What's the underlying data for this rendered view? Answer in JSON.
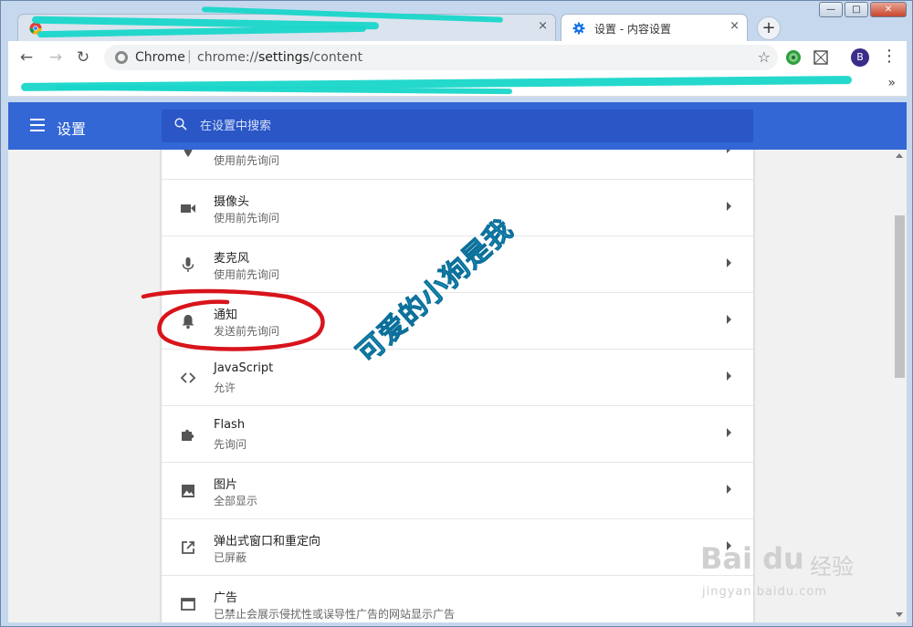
{
  "window": {
    "controls": {
      "minimize": "—",
      "maximize": "□",
      "close": "✕"
    }
  },
  "tabs": [
    {
      "title": "",
      "close": "×",
      "icon": "chrome-logo-icon"
    },
    {
      "title": "设置 - 内容设置",
      "close": "×",
      "icon": "gear-icon"
    }
  ],
  "toolbar": {
    "new_tab": "+",
    "back": "←",
    "forward": "→",
    "reload": "↻",
    "site_label": "Chrome",
    "separator": "|",
    "url_prefix": "chrome://",
    "url_host": "settings",
    "url_path": "/content",
    "star": "☆",
    "avatar_letter": "B",
    "menu": "⋮"
  },
  "bookmarks": {
    "overflow": "»"
  },
  "settings": {
    "title": "设置",
    "search_placeholder": "在设置中搜索"
  },
  "rows": [
    {
      "title": "",
      "subtitle": "使用前先询问",
      "icon": "location-icon"
    },
    {
      "title": "摄像头",
      "subtitle": "使用前先询问",
      "icon": "camera-icon"
    },
    {
      "title": "麦克风",
      "subtitle": "使用前先询问",
      "icon": "microphone-icon"
    },
    {
      "title": "通知",
      "subtitle": "发送前先询问",
      "icon": "bell-icon"
    },
    {
      "title": "JavaScript",
      "subtitle": "允许",
      "icon": "code-icon"
    },
    {
      "title": "Flash",
      "subtitle": "先询问",
      "icon": "puzzle-icon"
    },
    {
      "title": "图片",
      "subtitle": "全部显示",
      "icon": "image-icon"
    },
    {
      "title": "弹出式窗口和重定向",
      "subtitle": "已屏蔽",
      "icon": "open-in-new-icon"
    },
    {
      "title": "广告",
      "subtitle": "已禁止会展示侵扰性或误导性广告的网站显示广告",
      "icon": "ad-window-icon"
    }
  ],
  "annotations": {
    "handwritten": "可爱的小狗是我",
    "watermark_logo": "Bai du",
    "watermark_cn": "经验",
    "watermark_site": "jingyan.baidu.com",
    "circle_color": "#d8141b",
    "handwritten_color": "#3fd6f0"
  },
  "colors": {
    "header_blue": "#3367d6",
    "search_blue": "#2a56c6",
    "redaction": "#19d6c9"
  }
}
